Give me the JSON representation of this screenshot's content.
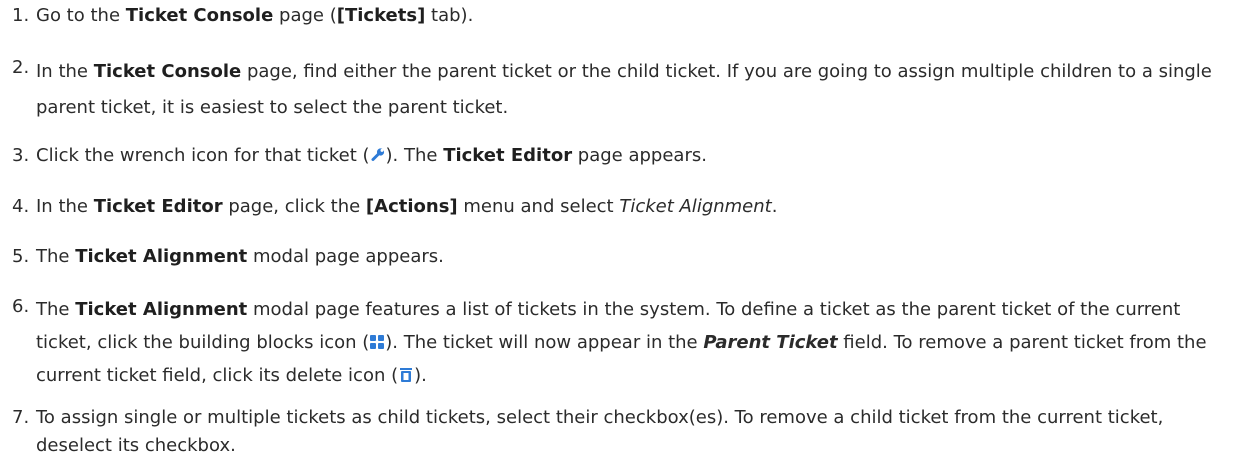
{
  "steps": [
    {
      "num": "1.",
      "t1": "Go to the ",
      "b1": "Ticket Console",
      "t2": " page (",
      "b2": "[Tickets]",
      "t3": " tab)."
    },
    {
      "num": "2.",
      "t1": "In the ",
      "b1": "Ticket Console",
      "t2": " page, find either the parent ticket or the child ticket. If you are going to assign multiple children to a single parent ticket, it is easiest to select the parent ticket."
    },
    {
      "num": "3.",
      "t1": "Click the wrench icon for that ticket (",
      "icon": "wrench-icon",
      "t2": "). The ",
      "b1": "Ticket Editor",
      "t3": " page appears."
    },
    {
      "num": "4.",
      "t1": "In the ",
      "b1": "Ticket Editor",
      "t2": " page, click the ",
      "b2": "[Actions]",
      "t3": " menu and select ",
      "i1": "Ticket Alignment",
      "t4": "."
    },
    {
      "num": "5.",
      "t1": "The ",
      "b1": "Ticket Alignment",
      "t2": " modal page appears."
    },
    {
      "num": "6.",
      "t1": "The ",
      "b1": "Ticket Alignment",
      "t2": " modal page features a list of tickets in the system. To define a ticket as the parent ticket of the current ticket, click the building blocks icon (",
      "icon1": "building-blocks-icon",
      "t3": "). The ticket will now appear in the ",
      "bi1": "Parent Ticket",
      "t4": " field. To remove a parent ticket from the current ticket field, click its delete icon (",
      "icon2": "delete-icon",
      "t5": ")."
    },
    {
      "num": "7.",
      "t1": "To assign single or multiple tickets as child tickets, select their checkbox(es). To remove a child ticket from the current ticket, deselect its checkbox."
    }
  ],
  "colors": {
    "text": "#2b2b2b",
    "icon_blue": "#2e7bd6"
  }
}
